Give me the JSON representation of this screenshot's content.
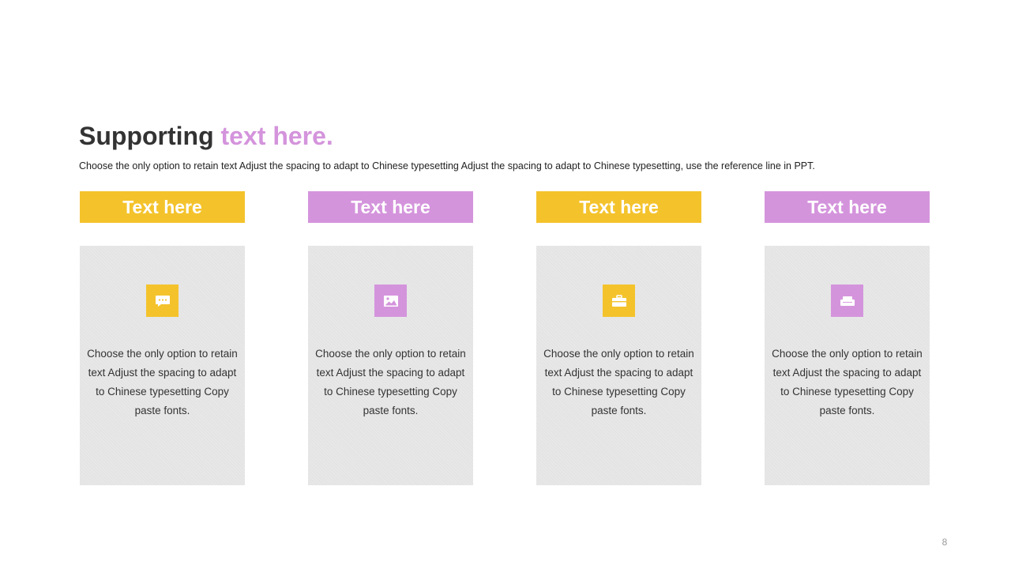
{
  "colors": {
    "yellow": "#f4c32c",
    "purple": "#d494dc",
    "card_bg": "#e4e4e4",
    "text_dark": "#333333"
  },
  "slide": {
    "title_part1": "Supporting",
    "title_part2": "text here.",
    "subtitle": "Choose the only option to retain text Adjust the spacing to adapt to Chinese typesetting Adjust the spacing to adapt to Chinese typesetting, use the reference line in PPT.",
    "page_number": "8"
  },
  "columns": [
    {
      "header": "Text here",
      "accent": "yellow",
      "icon": "chat-bubble-icon",
      "body": "Choose the only option to retain text Adjust the spacing to adapt to Chinese typesetting Copy paste fonts."
    },
    {
      "header": "Text here",
      "accent": "purple",
      "icon": "image-icon",
      "body": "Choose the only option to retain text Adjust the spacing to adapt to Chinese typesetting Copy paste fonts."
    },
    {
      "header": "Text here",
      "accent": "yellow",
      "icon": "briefcase-icon",
      "body": "Choose the only option to retain text Adjust the spacing to adapt to Chinese typesetting Copy paste fonts."
    },
    {
      "header": "Text here",
      "accent": "purple",
      "icon": "sofa-icon",
      "body": "Choose the only option to retain text Adjust the spacing to adapt to Chinese typesetting Copy paste fonts."
    }
  ]
}
